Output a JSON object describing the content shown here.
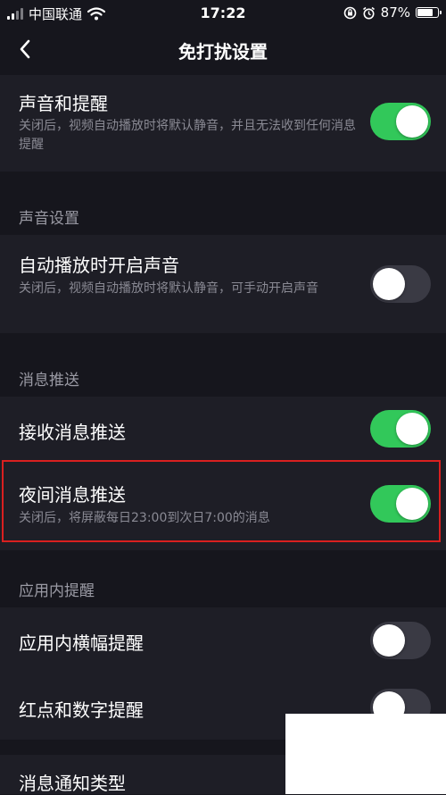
{
  "status_bar": {
    "carrier": "中国联通",
    "time": "17:22",
    "battery": "87%",
    "battery_level": 0.87
  },
  "nav": {
    "title": "免打扰设置",
    "back_icon": "chevron-left-icon"
  },
  "sections": [
    {
      "label": "",
      "rows": [
        {
          "title": "声音和提醒",
          "desc": "关闭后，视频自动播放时将默认静音，并且无法收到任何消息提醒",
          "on": true
        }
      ]
    },
    {
      "label": "声音设置",
      "rows": [
        {
          "title": "自动播放时开启声音",
          "desc": "关闭后，视频自动播放时将默认静音，可手动开启声音",
          "on": false
        }
      ]
    },
    {
      "label": "消息推送",
      "rows": [
        {
          "title": "接收消息推送",
          "desc": "",
          "on": true
        },
        {
          "title": "夜间消息推送",
          "desc": "关闭后，将屏蔽每日23:00到次日7:00的消息",
          "on": true
        }
      ]
    },
    {
      "label": "应用内提醒",
      "rows": [
        {
          "title": "应用内横幅提醒",
          "desc": "",
          "on": false
        },
        {
          "title": "红点和数字提醒",
          "desc": "",
          "on": false
        }
      ]
    },
    {
      "label": "",
      "rows": [
        {
          "title": "消息通知类型",
          "desc": ""
        }
      ]
    }
  ],
  "colors": {
    "background": "#16161d",
    "card": "#1e1e26",
    "toggle_on": "#32c85a",
    "toggle_off": "#3a3a44",
    "highlight": "#d92020"
  }
}
